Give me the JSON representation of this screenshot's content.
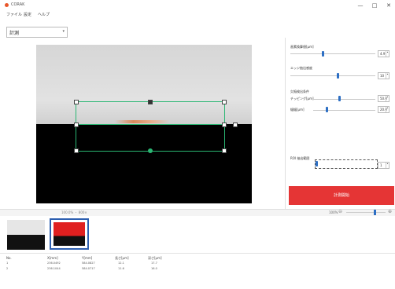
{
  "window": {
    "title": "CORAK",
    "controls": {
      "minimize": "—",
      "maximize": "□",
      "close": "✕"
    }
  },
  "menu": {
    "items": [
      "ファイル",
      "設定",
      "ヘルプ"
    ]
  },
  "mode_select": {
    "value": "計測",
    "arrow": "▾"
  },
  "panel": {
    "rows": [
      {
        "label": "画素換算値[μm]",
        "value": "4.9"
      },
      {
        "label": "エッジ抽出感度",
        "value": "10"
      }
    ],
    "section_title": "欠陥検出条件",
    "section_rows": [
      {
        "label": "チッピング[μm]",
        "value": "50.0"
      },
      {
        "label": "幅幅[μm]",
        "value": "20.0"
      }
    ],
    "dashed_label": "ROI 抽出範囲",
    "dashed_value": "1",
    "run_button": "計測開始",
    "arrow_up": "▴",
    "arrow_down": "▾"
  },
  "strip": {
    "caption": "100.0% ・ 800×",
    "zoom_label": "100%",
    "zoom_out": "⊖",
    "zoom_in": "⊕",
    "zoom_level": 0.72
  },
  "table": {
    "headers": [
      "No.",
      "X[mm]",
      "Y[mm]",
      "長さ[μm]",
      "深さ[μm]"
    ],
    "rows": [
      [
        "1",
        "236.0492",
        "584.0827",
        "12.1",
        "17.7"
      ],
      [
        "2",
        "236.1044",
        "584.0717",
        "11.6",
        "16.0"
      ]
    ]
  },
  "colors": {
    "accent": "#2d6fc4",
    "run": "#e53535",
    "roi": "#2bb673",
    "app_icon": "#e8562a"
  }
}
